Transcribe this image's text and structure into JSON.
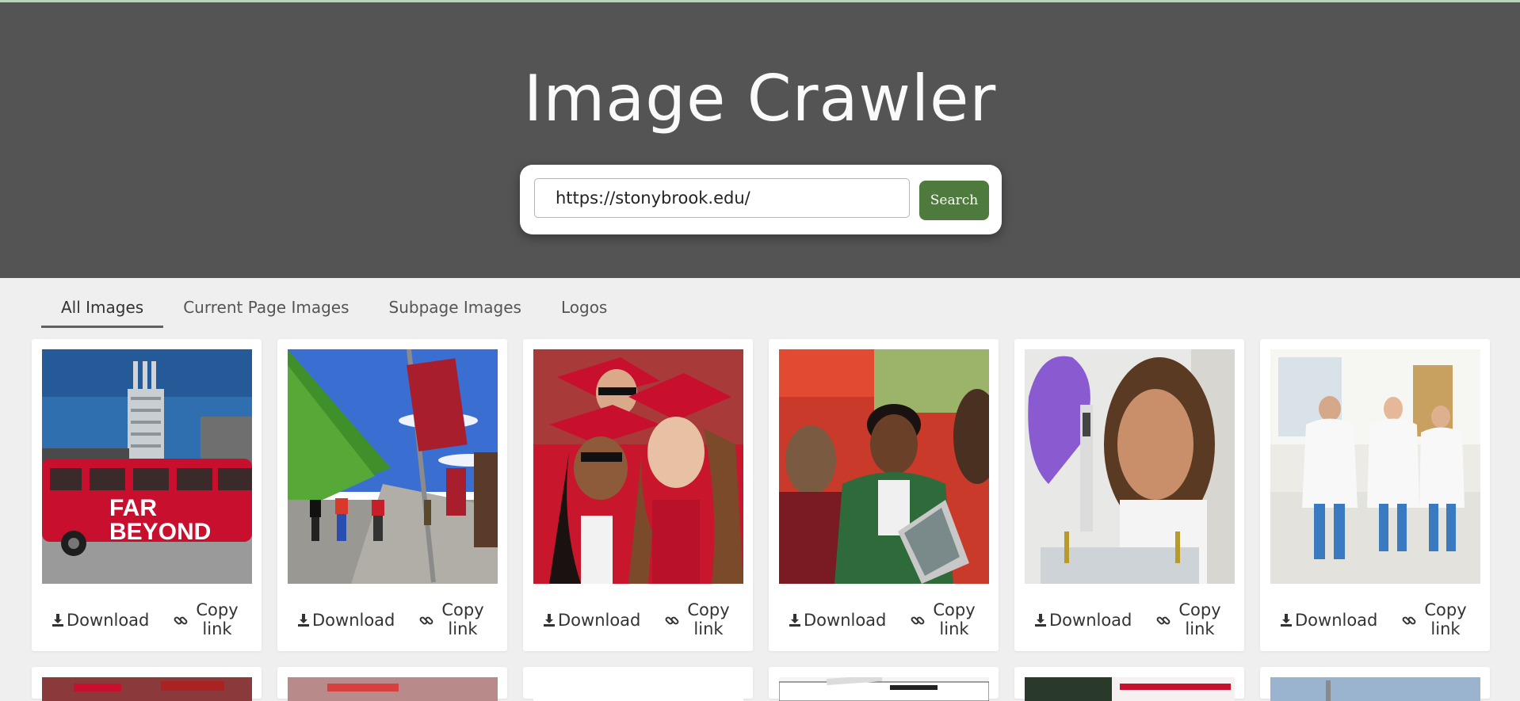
{
  "app": {
    "title": "Image Crawler"
  },
  "search": {
    "value": "https://stonybrook.edu/",
    "button_label": "Search"
  },
  "tabs": [
    {
      "label": "All Images",
      "active": true
    },
    {
      "label": "Current Page Images",
      "active": false
    },
    {
      "label": "Subpage Images",
      "active": false
    },
    {
      "label": "Logos",
      "active": false
    }
  ],
  "card_actions": {
    "download_label": "Download",
    "copy_label_1": "Copy",
    "copy_label_2": "link"
  },
  "images": [
    {
      "subject": "red university bus with tower",
      "caption_1": "FAR",
      "caption_2": "BEYOND"
    },
    {
      "subject": "campus walkway with banners"
    },
    {
      "subject": "graduates in red caps and gowns"
    },
    {
      "subject": "students talking at laptop"
    },
    {
      "subject": "researcher with pipette"
    },
    {
      "subject": "doctors walking in hospital lobby"
    }
  ],
  "row2_images": [
    {
      "subject": "crowd with red"
    },
    {
      "subject": "blurred red event"
    },
    {
      "subject": "blank"
    },
    {
      "subject": "newspaper clipping"
    },
    {
      "subject": "America's banner"
    },
    {
      "subject": "sky landscape"
    }
  ],
  "colors": {
    "header_bg": "#545454",
    "page_bg": "#efefef",
    "accent_green": "#4f7a3e",
    "brand_red": "#c8102e"
  }
}
